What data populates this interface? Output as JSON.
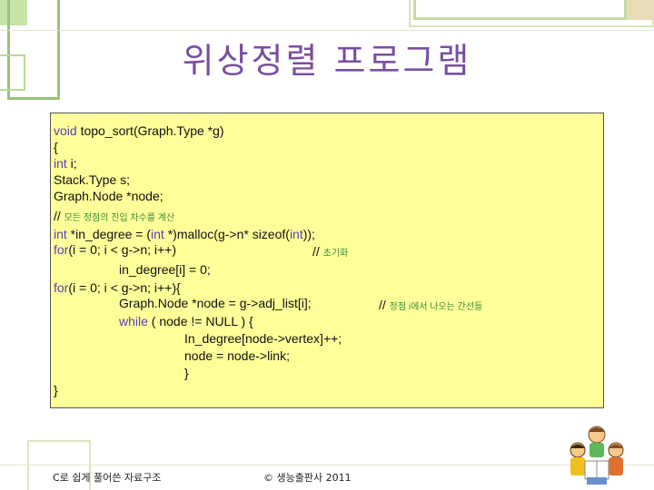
{
  "slide": {
    "title": "위상정렬 프로그램",
    "code": {
      "l01": {
        "kw": "void",
        "rest": " topo_sort(Graph.Type *g)"
      },
      "l02": "{",
      "l03": {
        "kw": "int",
        "rest": " i;"
      },
      "l04": "Stack.Type s;",
      "l05": "Graph.Node *node;",
      "l06": {
        "slash": "// ",
        "comment": "모든 정점의 진입 차수를 계산"
      },
      "l07": {
        "kw1": "int",
        "p1": " *in_degree = (",
        "kw2": "int",
        "p2": " *)malloc(g->n* sizeof(",
        "kw3": "int",
        "p3": "));"
      },
      "l08": {
        "kw": "for",
        "rest": "(i = 0; i < g->n; i++)",
        "slash": "// ",
        "comment": "초기화"
      },
      "l09": "in_degree[i] = 0;",
      "l10": {
        "kw": "for",
        "rest": "(i = 0; i < g->n; i++){"
      },
      "l11": {
        "text": "Graph.Node *node = g->adj_list[i];",
        "slash": "// ",
        "comment": "정점 i에서 나오는 간선들"
      },
      "l12": {
        "kw": "while",
        "rest": " ( node != NULL ) {"
      },
      "l13": "In_degree[node->vertex]++;",
      "l14": "node = node->link;",
      "l15": "}",
      "l16": "}"
    },
    "footer": {
      "left": "C로 쉽게 풀어쓴 자료구조",
      "center": "© 생능출판사 2011"
    },
    "colors": {
      "title": "#7a4fa0",
      "code_bg": "#ffff99",
      "keyword": "#5a3fb0",
      "comment": "#3a8f3a"
    },
    "illustration_icon": "children-reading-icon"
  }
}
